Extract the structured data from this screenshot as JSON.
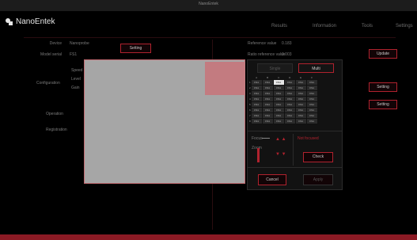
{
  "window": {
    "title": "NanoEntek"
  },
  "app": {
    "logo_text": "NanoEntek"
  },
  "nav": {
    "items": [
      "Results",
      "Information",
      "Tools",
      "Settings"
    ]
  },
  "left_panel": {
    "device_label": "Device",
    "device_value": "Nanoprobe",
    "model_label": "Model serial",
    "model_value": "FS1",
    "setting_button": "Setting",
    "section_1": "Configuration",
    "section_2": "Operation",
    "section_3": "Registration",
    "side_lines": [
      "Speed",
      "Level",
      "Gain"
    ]
  },
  "right_panel": {
    "ref_label": "Reference value",
    "ref_value": "0.183",
    "ref2_label": "Ratio reference value",
    "ref2_value": "0.003",
    "update_button": "Update",
    "setting_button": "Setting",
    "setting2_button": "Setting"
  },
  "popup": {
    "tabs": [
      "Single",
      "Multi"
    ],
    "column_headers": [
      "A",
      "B",
      "C",
      "D",
      "E",
      "F"
    ],
    "rows": [
      {
        "label": "1",
        "cells": [
          "FS1",
          "FS1",
          "FS1",
          "FS1",
          "FS1",
          "FS1"
        ]
      },
      {
        "label": "2",
        "cells": [
          "FS1",
          "FS1",
          "FS1",
          "FS1",
          "FS1",
          "FS1"
        ]
      },
      {
        "label": "3",
        "cells": [
          "FS1",
          "FS1",
          "FS1",
          "FS1",
          "FS1",
          "FS1"
        ]
      },
      {
        "label": "4",
        "cells": [
          "FS1",
          "FS1",
          "FS1",
          "FS1",
          "FS1",
          "FS1"
        ]
      },
      {
        "label": "5",
        "cells": [
          "FS1",
          "FS1",
          "FS1",
          "FS1",
          "FS1",
          "FS1"
        ]
      },
      {
        "label": "6",
        "cells": [
          "FS1",
          "FS1",
          "FS1",
          "FS1",
          "FS1",
          "FS1"
        ]
      },
      {
        "label": "7",
        "cells": [
          "FS1",
          "FS1",
          "FS1",
          "FS1",
          "FS1",
          "FS1"
        ]
      },
      {
        "label": "8",
        "cells": [
          "FS1",
          "FS1",
          "FS1",
          "FS1",
          "FS1",
          "FS1"
        ]
      }
    ],
    "selected_cell": {
      "row": 0,
      "col": 2
    },
    "focus_label": "Focus",
    "zoom_label": "Zoom",
    "focus_status": "Not focused",
    "check_button": "Check",
    "cancel_button": "Cancel",
    "apply_button": "Apply"
  },
  "colors": {
    "accent": "#b0222e",
    "bottom_bar": "#8b1a24",
    "preview_bg": "#a6a6a6",
    "roi": "#c37b80"
  }
}
